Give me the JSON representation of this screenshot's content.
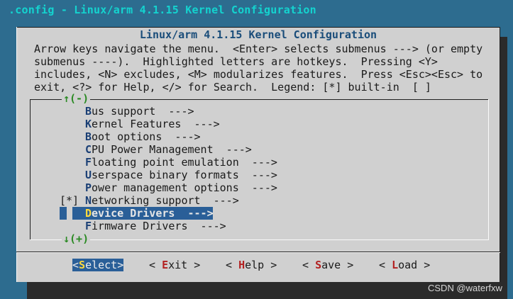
{
  "window": {
    "title": ".config - Linux/arm 4.1.15 Kernel Configuration"
  },
  "dialog": {
    "title": "Linux/arm 4.1.15 Kernel Configuration",
    "help_lines": [
      "Arrow keys navigate the menu.  <Enter> selects submenus ---> (or empty",
      "submenus ----).  Highlighted letters are hotkeys.  Pressing <Y>",
      "includes, <N> excludes, <M> modularizes features.  Press <Esc><Esc> to",
      "exit, <?> for Help, </> for Search.  Legend: [*] built-in  [ ]"
    ],
    "scroll_up": "↑(-)",
    "scroll_down": "↓(+)"
  },
  "menu": {
    "items": [
      {
        "hotkey": "B",
        "rest": "us support  --->"
      },
      {
        "hotkey": "K",
        "rest": "ernel Features  --->"
      },
      {
        "hotkey": "B",
        "rest": "oot options  --->"
      },
      {
        "hotkey": "C",
        "rest": "PU Power Management  --->"
      },
      {
        "hotkey": "F",
        "rest": "loating point emulation  --->"
      },
      {
        "hotkey": "U",
        "rest": "serspace binary formats  --->"
      },
      {
        "hotkey": "P",
        "rest": "ower management options  --->"
      },
      {
        "prefix": "[*]",
        "hotkey": "N",
        "rest": "etworking support  --->"
      },
      {
        "hotkey": "D",
        "rest": "evice Drivers  --->",
        "selected": true
      },
      {
        "hotkey": "F",
        "rest": "irmware Drivers  --->"
      }
    ]
  },
  "buttons": [
    {
      "open": "<",
      "hotkey": "S",
      "rest": "elect",
      "close": ">",
      "active": true
    },
    {
      "open": "< ",
      "hotkey": "E",
      "rest": "xit",
      "close": " >"
    },
    {
      "open": "< ",
      "hotkey": "H",
      "rest": "elp",
      "close": " >"
    },
    {
      "open": "< ",
      "hotkey": "S",
      "rest": "ave",
      "close": " >"
    },
    {
      "open": "< ",
      "hotkey": "L",
      "rest": "oad",
      "close": " >"
    }
  ],
  "watermark": "CSDN @waterfxw",
  "colors": {
    "background": "#2d6c8f",
    "dialog": "#d0d0d0",
    "selection": "#2a5f98",
    "hotkey": "#1a3f75",
    "title": "#1a4d7a",
    "scroll_arrow": "#2a8a23"
  }
}
